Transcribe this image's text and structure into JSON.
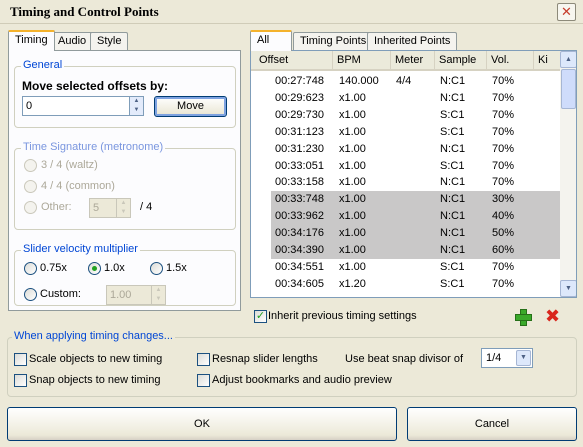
{
  "window": {
    "title": "Timing and Control Points",
    "close_glyph": "✕"
  },
  "left_tabs": [
    "Timing",
    "Audio",
    "Style"
  ],
  "general": {
    "title": "General",
    "move_label": "Move selected offsets by:",
    "offset_value": "0",
    "move_button": "Move"
  },
  "time_signature": {
    "title": "Time Signature (metronome)",
    "waltz": "3 / 4 (waltz)",
    "common": "4 / 4 (common)",
    "other": "Other:",
    "other_value": "5",
    "denominator": "/ 4"
  },
  "slider_velocity": {
    "title": "Slider velocity multiplier",
    "opt_075": "0.75x",
    "opt_10": "1.0x",
    "opt_15": "1.5x",
    "custom": "Custom:",
    "custom_value": "1.00",
    "selected": "1.0x"
  },
  "right_tabs": [
    "All",
    "Timing Points",
    "Inherited Points"
  ],
  "table": {
    "columns": [
      "Offset",
      "BPM",
      "Meter",
      "Sample",
      "Vol.",
      "Ki"
    ],
    "rows": [
      {
        "offset": "00:27:748",
        "bpm": "140.000",
        "meter": "4/4",
        "sample": "N:C1",
        "vol": "70%",
        "selected": false
      },
      {
        "offset": "00:29:623",
        "bpm": "x1.00",
        "meter": "",
        "sample": "N:C1",
        "vol": "70%",
        "selected": false
      },
      {
        "offset": "00:29:730",
        "bpm": "x1.00",
        "meter": "",
        "sample": "S:C1",
        "vol": "70%",
        "selected": false
      },
      {
        "offset": "00:31:123",
        "bpm": "x1.00",
        "meter": "",
        "sample": "S:C1",
        "vol": "70%",
        "selected": false
      },
      {
        "offset": "00:31:230",
        "bpm": "x1.00",
        "meter": "",
        "sample": "N:C1",
        "vol": "70%",
        "selected": false
      },
      {
        "offset": "00:33:051",
        "bpm": "x1.00",
        "meter": "",
        "sample": "S:C1",
        "vol": "70%",
        "selected": false
      },
      {
        "offset": "00:33:158",
        "bpm": "x1.00",
        "meter": "",
        "sample": "N:C1",
        "vol": "70%",
        "selected": false
      },
      {
        "offset": "00:33:748",
        "bpm": "x1.00",
        "meter": "",
        "sample": "N:C1",
        "vol": "30%",
        "selected": true
      },
      {
        "offset": "00:33:962",
        "bpm": "x1.00",
        "meter": "",
        "sample": "N:C1",
        "vol": "40%",
        "selected": true
      },
      {
        "offset": "00:34:176",
        "bpm": "x1.00",
        "meter": "",
        "sample": "N:C1",
        "vol": "50%",
        "selected": true
      },
      {
        "offset": "00:34:390",
        "bpm": "x1.00",
        "meter": "",
        "sample": "N:C1",
        "vol": "60%",
        "selected": true
      },
      {
        "offset": "00:34:551",
        "bpm": "x1.00",
        "meter": "",
        "sample": "S:C1",
        "vol": "70%",
        "selected": false
      },
      {
        "offset": "00:34:605",
        "bpm": "x1.20",
        "meter": "",
        "sample": "S:C1",
        "vol": "70%",
        "selected": false
      }
    ]
  },
  "inherit_label": "Inherit previous timing settings",
  "icons": {
    "add": "plus-icon",
    "remove": "x-icon",
    "remove_glyph": "✖"
  },
  "apply_changes": {
    "title": "When applying timing changes...",
    "scale": "Scale objects to new timing",
    "snap": "Snap objects to new timing",
    "resnap": "Resnap slider lengths",
    "adjust": "Adjust bookmarks and audio preview",
    "divisor_label": "Use beat snap divisor of",
    "divisor_value": "1/4"
  },
  "footer": {
    "ok": "OK",
    "cancel": "Cancel"
  },
  "colors": {
    "accent": "#0046d5",
    "selected_row": "#c9c8c8",
    "tab_highlight": "#f4b22c"
  }
}
